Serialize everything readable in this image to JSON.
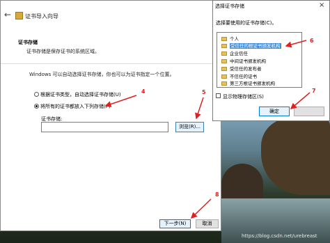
{
  "wizard": {
    "back_glyph": "←",
    "title": "证书导入向导",
    "section_title": "证书存储",
    "section_desc": "证书存储是保存证书的系统区域。",
    "windows_desc": "Windows 可以自动选择证书存储，你也可以为证书指定一个位置。",
    "radio_auto": "根据证书类型，自动选择证书存储(U)",
    "radio_all": "将所有的证书都放入下列存储(P)",
    "store_label": "证书存储:",
    "store_value": "",
    "browse_label": "浏览(R)...",
    "next_label": "下一步(N)",
    "cancel_label": "取消"
  },
  "dialog": {
    "title": "选择证书存储",
    "close_glyph": "×",
    "prompt": "选择要使用的证书存储(C)。",
    "stores": [
      "个人",
      "受信任的根证书颁发机构",
      "企业信任",
      "中间证书颁发机构",
      "受信任的发布者",
      "不信任的证书",
      "第三方根证书颁发机构"
    ],
    "selected_index": 1,
    "show_physical_label": "显示物理存储区(S)",
    "ok_label": "确定"
  },
  "annotations": [
    "4",
    "5",
    "6",
    "7",
    "8"
  ],
  "watermark": "https://blog.csdn.net/urebreast",
  "colors": {
    "accent": "#0078d7",
    "annotation": "#e02020",
    "selection": "#3f8fe0"
  }
}
